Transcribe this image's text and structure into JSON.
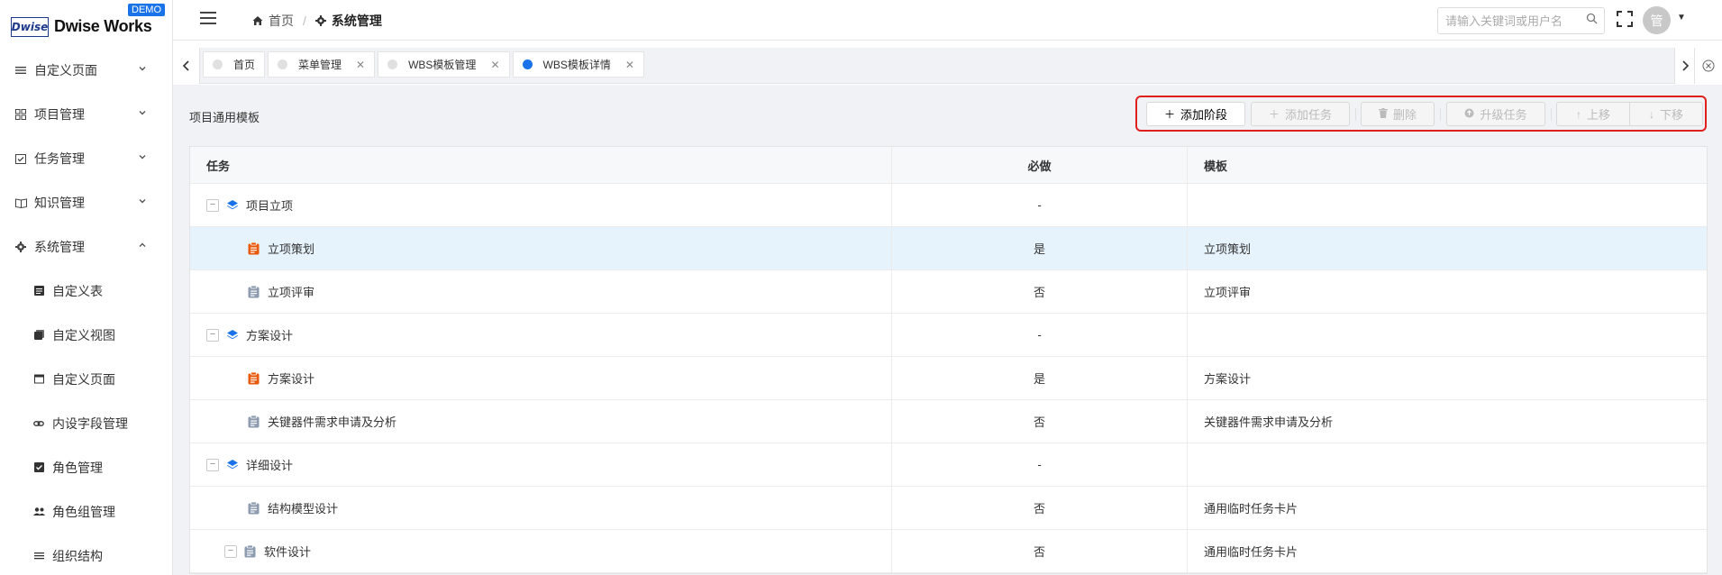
{
  "app": {
    "logo_mark": "Dwise",
    "name": "Dwise Works",
    "demo_badge": "DEMO"
  },
  "sidebar": {
    "items": [
      {
        "label": "自定义页面",
        "icon": "list-icon",
        "arrow": "chevron-down"
      },
      {
        "label": "项目管理",
        "icon": "grid-icon",
        "arrow": "chevron-down"
      },
      {
        "label": "任务管理",
        "icon": "calendar-check-icon",
        "arrow": "chevron-down"
      },
      {
        "label": "知识管理",
        "icon": "book-icon",
        "arrow": "chevron-down"
      },
      {
        "label": "系统管理",
        "icon": "gear-icon",
        "arrow": "chevron-up"
      }
    ],
    "sub_items": [
      {
        "label": "自定义表",
        "icon": "table-icon"
      },
      {
        "label": "自定义视图",
        "icon": "layers-icon"
      },
      {
        "label": "自定义页面",
        "icon": "window-icon"
      },
      {
        "label": "内设字段管理",
        "icon": "link-icon"
      },
      {
        "label": "角色管理",
        "icon": "checkbox-icon"
      },
      {
        "label": "角色组管理",
        "icon": "users-icon"
      },
      {
        "label": "组织结构",
        "icon": "list-icon"
      }
    ]
  },
  "header": {
    "breadcrumb": [
      {
        "label": "首页",
        "icon": "home-icon"
      },
      {
        "label": "系统管理",
        "icon": "gear-icon"
      }
    ],
    "search_placeholder": "请输入关键词或用户名",
    "avatar_text": "管"
  },
  "tabs": [
    {
      "label": "首页",
      "active": false,
      "closable": false
    },
    {
      "label": "菜单管理",
      "active": false,
      "closable": true
    },
    {
      "label": "WBS模板管理",
      "active": false,
      "closable": true
    },
    {
      "label": "WBS模板详情",
      "active": true,
      "closable": true
    }
  ],
  "panel": {
    "title": "项目通用模板",
    "toolbar": {
      "add_stage": "添加阶段",
      "add_task": "添加任务",
      "delete": "删除",
      "upgrade_task": "升级任务",
      "move_up": "上移",
      "move_down": "下移"
    }
  },
  "table": {
    "headers": [
      "任务",
      "必做",
      "模板"
    ],
    "rows": [
      {
        "task": "项目立项",
        "required": "-",
        "template": "",
        "type": "stage",
        "collapsible": true
      },
      {
        "task": "立项策划",
        "required": "是",
        "template": "立项策划",
        "type": "task-required",
        "collapsible": false
      },
      {
        "task": "立项评审",
        "required": "否",
        "template": "立项评审",
        "type": "task",
        "collapsible": false
      },
      {
        "task": "方案设计",
        "required": "-",
        "template": "",
        "type": "stage",
        "collapsible": true
      },
      {
        "task": "方案设计",
        "required": "是",
        "template": "方案设计",
        "type": "task-required",
        "collapsible": false
      },
      {
        "task": "关键器件需求申请及分析",
        "required": "否",
        "template": "关键器件需求申请及分析",
        "type": "task",
        "collapsible": false
      },
      {
        "task": "详细设计",
        "required": "-",
        "template": "",
        "type": "stage",
        "collapsible": true
      },
      {
        "task": "结构模型设计",
        "required": "否",
        "template": "通用临时任务卡片",
        "type": "task",
        "collapsible": false
      },
      {
        "task": "软件设计",
        "required": "否",
        "template": "通用临时任务卡片",
        "type": "task",
        "collapsible": true
      }
    ]
  },
  "colors": {
    "accent": "#1a73e8",
    "highlight_row": "#e6f3fc",
    "toolbar_outline": "#e0201c",
    "required_task_icon": "#e8590c",
    "optional_task_icon": "#8c9bb0",
    "stage_icon": "#1a73e8"
  }
}
